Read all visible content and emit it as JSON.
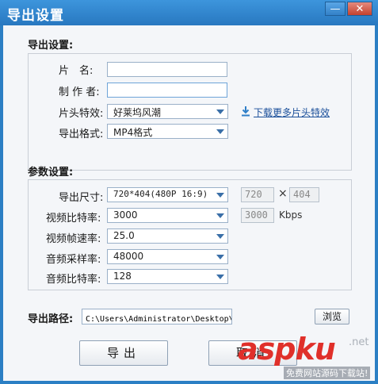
{
  "window": {
    "title": "导出设置",
    "min_glyph": "—",
    "close_glyph": "✕"
  },
  "export_section": {
    "title": "导出设置:",
    "piece_name_label": "片　名:",
    "piece_name_value": "",
    "author_label": "制 作 者:",
    "author_value": "",
    "intro_effect_label": "片头特效:",
    "intro_effect_value": "好莱坞风潮",
    "download_link": "下载更多片头特效",
    "format_label": "导出格式:",
    "format_value": "MP4格式"
  },
  "param_section": {
    "title": "参数设置:",
    "size_label": "导出尺寸:",
    "size_value": "720*404(480P 16:9)",
    "width_value": "720",
    "times": "×",
    "height_value": "404",
    "video_bitrate_label": "视频比特率:",
    "video_bitrate_value": "3000",
    "video_bitrate_box": "3000",
    "kbps": "Kbps",
    "framerate_label": "视频帧速率:",
    "framerate_value": "25.0",
    "samplerate_label": "音频采样率:",
    "samplerate_value": "48000",
    "audio_bitrate_label": "音频比特率:",
    "audio_bitrate_value": "128"
  },
  "path": {
    "label": "导出路径:",
    "value": "C:\\Users\\Administrator\\Desktop\\爱剪辑-我的视",
    "browse": "浏览"
  },
  "buttons": {
    "export": "导出",
    "cancel": "取消"
  },
  "watermark": {
    "main": "aspku",
    "net": ".net",
    "sub": "免费网站源码下载站!"
  },
  "colors": {
    "titlebar": "#2b7fc4",
    "link": "#1a4f9a",
    "watermark": "#e0302a"
  }
}
